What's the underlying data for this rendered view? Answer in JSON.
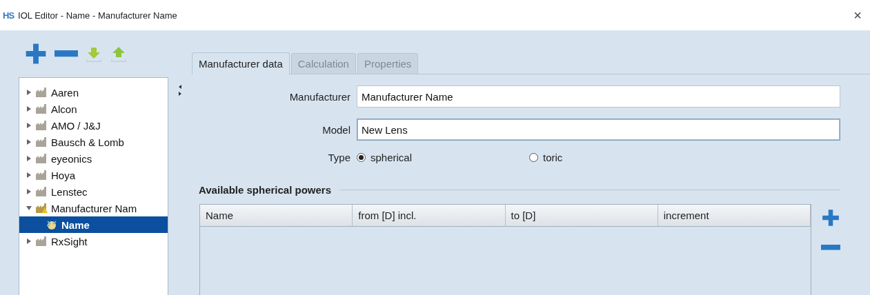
{
  "window": {
    "title": "IOL Editor - Name - Manufacturer Name",
    "logo": "HS",
    "close": "×"
  },
  "tree": {
    "items": [
      {
        "label": "Aaren",
        "expanded": false,
        "selected": false
      },
      {
        "label": "Alcon",
        "expanded": false,
        "selected": false
      },
      {
        "label": "AMO / J&J",
        "expanded": false,
        "selected": false
      },
      {
        "label": "Bausch & Lomb",
        "expanded": false,
        "selected": false
      },
      {
        "label": "eyeonics",
        "expanded": false,
        "selected": false
      },
      {
        "label": "Hoya",
        "expanded": false,
        "selected": false
      },
      {
        "label": "Lenstec",
        "expanded": false,
        "selected": false
      },
      {
        "label": "Manufacturer Nam",
        "expanded": true,
        "selected": false,
        "children": [
          {
            "label": "Name",
            "selected": true
          }
        ]
      },
      {
        "label": "RxSight",
        "expanded": false,
        "selected": false
      }
    ]
  },
  "tabs": [
    {
      "label": "Manufacturer data",
      "selected": true,
      "disabled": false
    },
    {
      "label": "Calculation",
      "selected": false,
      "disabled": true
    },
    {
      "label": "Properties",
      "selected": false,
      "disabled": true
    }
  ],
  "form": {
    "manufacturer": {
      "label": "Manufacturer",
      "value": "Manufacturer Name"
    },
    "model": {
      "label": "Model",
      "value": "New Lens"
    },
    "type": {
      "label": "Type",
      "options": [
        {
          "label": "spherical",
          "selected": true
        },
        {
          "label": "toric",
          "selected": false
        }
      ]
    }
  },
  "powers": {
    "title": "Available spherical powers",
    "columns": [
      "Name",
      "from [D] incl.",
      "to [D]",
      "increment"
    ]
  }
}
